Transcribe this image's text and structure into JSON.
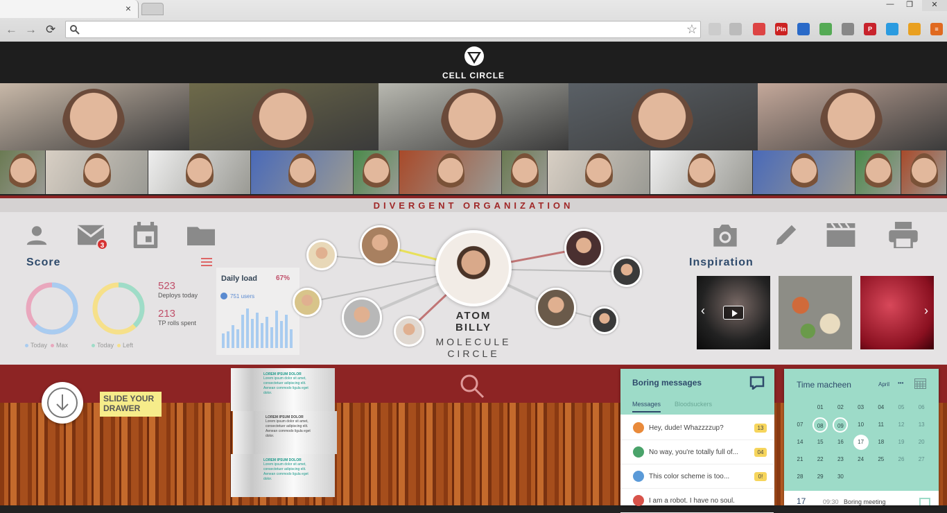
{
  "browser": {
    "tab_close": "×",
    "window_controls": [
      "—",
      "❐",
      "✕"
    ],
    "nav": {
      "back": "←",
      "forward": "→",
      "reload": "⟳"
    },
    "extensions": [
      {
        "name": "gmail-icon",
        "color": "#d44"
      },
      {
        "name": "pin-icon",
        "label": "Pin",
        "color": "#c22"
      },
      {
        "name": "download-icon",
        "color": "#2a6ac8"
      },
      {
        "name": "evernote-icon",
        "color": "#5a5"
      },
      {
        "name": "mail-checker-icon",
        "color": "#888"
      },
      {
        "name": "pinterest-icon",
        "label": "P",
        "color": "#c8232c"
      },
      {
        "name": "x-extension-icon",
        "color": "#2b9be0"
      },
      {
        "name": "chrome-ext-icon",
        "color": "#e9a020"
      },
      {
        "name": "menu-icon",
        "label": "≡",
        "color": "#e06a20"
      }
    ]
  },
  "app": {
    "brand": "CELL CIRCLE",
    "section": "DIVERGENT ORGANIZATION"
  },
  "dashboard": {
    "score_title": "Score",
    "mail_badge": "3",
    "stats": [
      {
        "value": "523",
        "label": "Deploys today"
      },
      {
        "value": "213",
        "label": "TP rolls spent"
      }
    ],
    "donut1": {
      "today_pct": 0.62,
      "legend": [
        "Today",
        "Max"
      ]
    },
    "donut2": {
      "today_pct": 0.38,
      "legend": [
        "Today",
        "Left"
      ]
    },
    "daily": {
      "title": "Daily load",
      "pct": "67%",
      "users": "751 users",
      "bars": [
        0.35,
        0.4,
        0.55,
        0.45,
        0.8,
        0.95,
        0.7,
        0.85,
        0.6,
        0.75,
        0.5,
        0.9,
        0.65,
        0.8,
        0.45
      ]
    },
    "molecule": {
      "name1": "ATOM",
      "name2": "BILLY",
      "sub1": "MOLECULE",
      "sub2": "CIRCLE"
    },
    "inspiration_title": "Inspiration"
  },
  "drawer": {
    "label1": "SLIDE YOUR",
    "label2": "DRAWER"
  },
  "folded": [
    {
      "title": "LOREM IPSUM DOLOR",
      "text": "Lorem ipsum dolor sit amet, consectetuer adipiscing elit. Aenean commodo ligula eget dolor."
    },
    {
      "title": "LOREM IPSUM DOLOR",
      "text": "Lorem ipsum dolor sit amet, consectetuer adipiscing elit. Aenean commodo ligula eget dolor."
    },
    {
      "title": "LOREM IPSUM DOLOR",
      "text": "Lorem ipsum dolor sit amet, consectetuer adipiscing elit. Aenean commodo ligula eget dolor."
    }
  ],
  "messages": {
    "title": "Boring messages",
    "tabs": [
      "Messages",
      "Bloodsuckers"
    ],
    "items": [
      {
        "text": "Hey, dude! Whazzzzup?",
        "count": "13",
        "color": "#e98a3a"
      },
      {
        "text": "No way, you're totally full of...",
        "count": "04",
        "color": "#4aa36a"
      },
      {
        "text": "This color scheme is too...",
        "count": "0!",
        "color": "#5a9ad8"
      },
      {
        "text": "I am a robot. I have no soul.",
        "count": "",
        "color": "#d8534a"
      }
    ]
  },
  "calendar": {
    "title": "Time macheen",
    "month": "April",
    "more": "•••",
    "rows": [
      [
        "",
        "01",
        "02",
        "03",
        "04",
        "05",
        "06"
      ],
      [
        "07",
        "08",
        "09",
        "10",
        "11",
        "12",
        "13"
      ],
      [
        "14",
        "15",
        "16",
        "17",
        "18",
        "19",
        "20"
      ],
      [
        "21",
        "22",
        "23",
        "24",
        "25",
        "26",
        "27"
      ],
      [
        "28",
        "29",
        "30",
        "",
        "",
        "",
        ""
      ]
    ],
    "event": {
      "day": "17",
      "time": "09:30",
      "title": "Boring meeting"
    }
  }
}
